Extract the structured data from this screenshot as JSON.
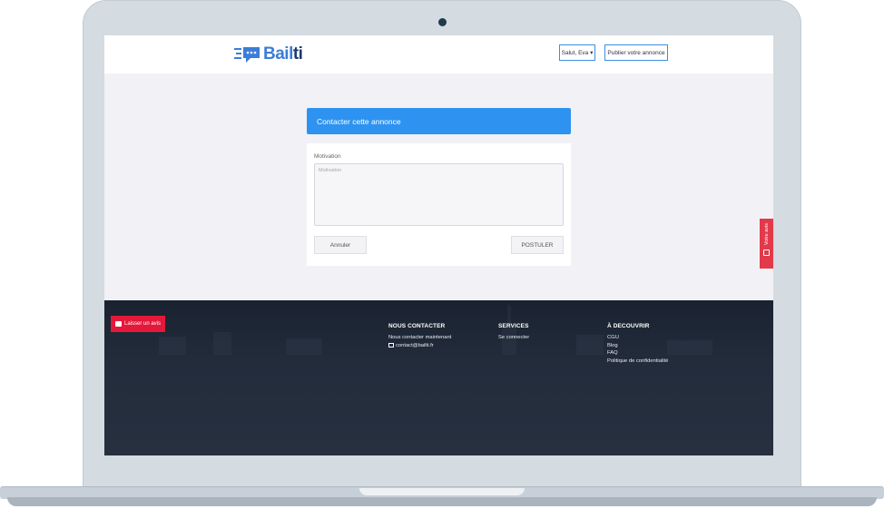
{
  "brand": {
    "logo_part1": "Bail",
    "logo_part2": "ti",
    "color_primary": "#2e93f0",
    "color_red": "#e4183a"
  },
  "navbar": {
    "user_menu": "Salut, Eva ▾",
    "publish_button": "Publier votre annonce"
  },
  "form": {
    "header": "Contacter cette annonce",
    "motivation_label": "Motivation",
    "motivation_placeholder": "Motivation",
    "cancel_button": "Annuler",
    "submit_button": "POSTULER"
  },
  "side_tab": {
    "label": "Votre avis"
  },
  "footer": {
    "review_button": "Laisser un avis",
    "contact": {
      "title": "NOUS CONTACTER",
      "items": [
        "Nous contacter maintenant",
        "contact@bailti.fr"
      ]
    },
    "services": {
      "title": "SERVICES",
      "items": [
        "Se connecter"
      ]
    },
    "discover": {
      "title": "À DECOUVRIR",
      "items": [
        "CGU",
        "Blog",
        "FAQ",
        "Politique de confidentialité"
      ]
    }
  }
}
